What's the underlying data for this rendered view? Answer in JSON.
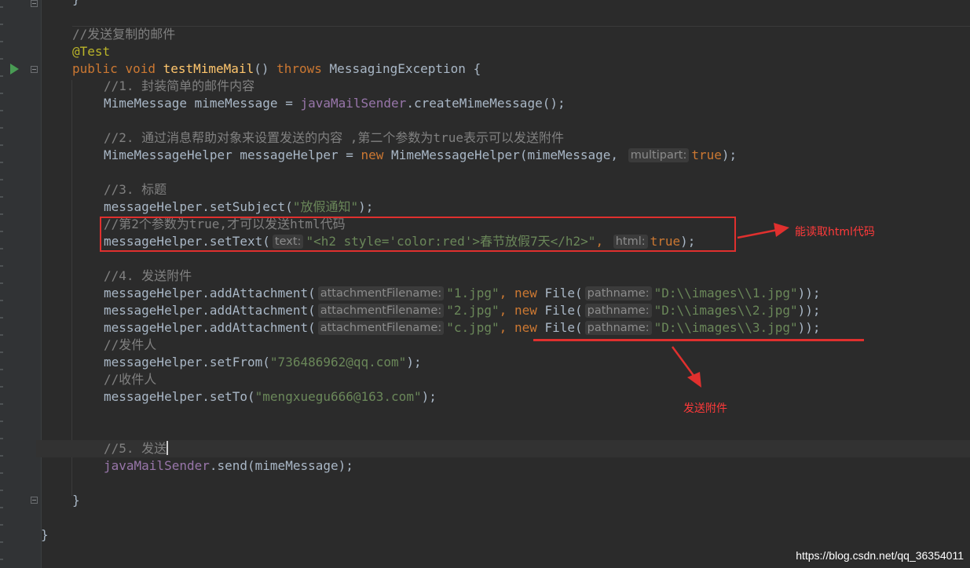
{
  "editor": {
    "lines": {
      "l0": "}",
      "l1_comment": "//发送复制的邮件",
      "l2_annotation": "@Test",
      "l3": {
        "public": "public",
        "void": "void",
        "method": "testMimeMail",
        "paren": "()",
        "throws": "throws",
        "rest": "MessagingException {"
      },
      "l4_comment": "//1. 封装简单的邮件内容",
      "l5": {
        "pre": "MimeMessage mimeMessage = ",
        "field": "javaMailSender",
        "post": ".createMimeMessage();"
      },
      "l7_comment": "//2. 通过消息帮助对象来设置发送的内容 ,第二个参数为true表示可以发送附件",
      "l8": {
        "pre": "MimeMessageHelper messageHelper = ",
        "new": "new",
        "mid": " MimeMessageHelper(mimeMessage,",
        "hint": "multipart:",
        "val": "true",
        "end": ");"
      },
      "l10_comment": "//3. 标题",
      "l11": {
        "pre": "messageHelper.setSubject(",
        "str": "\"放假通知\"",
        "end": ");"
      },
      "l12_comment": "//第2个参数为true,才可以发送html代码",
      "l13": {
        "pre": "messageHelper.setText(",
        "hint1": "text:",
        "str": "\"<h2 style='color:red'>春节放假7天</h2>\"",
        "comma": ",",
        "hint2": "html:",
        "val": "true",
        "end": ");"
      },
      "l15_comment": "//4. 发送附件",
      "att1": {
        "pre": "messageHelper.addAttachment(",
        "hint1": "attachmentFilename:",
        "str1": "\"1.jpg\"",
        "comma": ",",
        "new": "new",
        "file": " File(",
        "hint2": "pathname:",
        "str2": "\"D:\\\\images\\\\1.jpg\"",
        "end": "));"
      },
      "att2": {
        "pre": "messageHelper.addAttachment(",
        "hint1": "attachmentFilename:",
        "str1": "\"2.jpg\"",
        "comma": ",",
        "new": "new",
        "file": " File(",
        "hint2": "pathname:",
        "str2": "\"D:\\\\images\\\\2.jpg\"",
        "end": "));"
      },
      "att3": {
        "pre": "messageHelper.addAttachment(",
        "hint1": "attachmentFilename:",
        "str1": "\"c.jpg\"",
        "comma": ",",
        "new": "new",
        "file": " File(",
        "hint2": "pathname:",
        "str2": "\"D:\\\\images\\\\3.jpg\"",
        "end": "));"
      },
      "l19_comment": "//发件人",
      "l20": {
        "pre": "messageHelper.setFrom(",
        "str": "\"736486962@qq.com\"",
        "end": ");"
      },
      "l21_comment": "//收件人",
      "l22": {
        "pre": "messageHelper.setTo(",
        "str": "\"mengxuegu666@163.com\"",
        "end": ");"
      },
      "l26_comment": "//5. 发送",
      "l27": {
        "field": "javaMailSender",
        "post": ".send(mimeMessage);"
      },
      "l29": "}",
      "l31": "}"
    }
  },
  "annotations": {
    "html_note": "能读取html代码",
    "attach_note": "发送附件",
    "color": "#e0302e"
  },
  "watermark": "https://blog.csdn.net/qq_36354011"
}
